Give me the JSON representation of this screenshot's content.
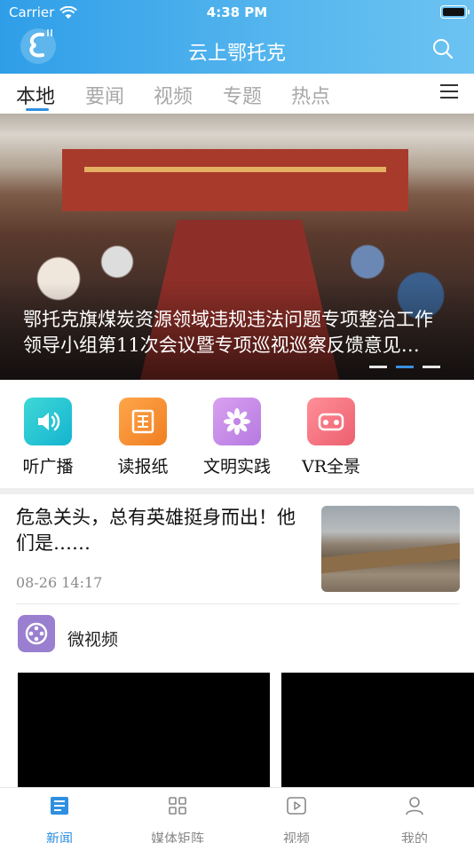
{
  "status_bar": {
    "carrier": "Carrier",
    "time": "4:38 PM"
  },
  "header": {
    "title": "云上鄂托克"
  },
  "tabs": [
    {
      "label": "本地",
      "active": true
    },
    {
      "label": "要闻"
    },
    {
      "label": "视频"
    },
    {
      "label": "专题"
    },
    {
      "label": "热点"
    }
  ],
  "banner": {
    "caption_line1": "鄂托克旗煤炭资源领域违规违法问题专项整治工作",
    "caption_line2": "领导小组第11次会议暨专项巡视巡察反馈意见…",
    "pages": 3,
    "current_page": 2
  },
  "quick_links": [
    {
      "label": "听广播",
      "icon": "speaker-icon",
      "color": "#27c6cf"
    },
    {
      "label": "读报纸",
      "icon": "newspaper-icon",
      "color": "#f48a2e"
    },
    {
      "label": "文明实践",
      "icon": "flower-icon",
      "color": "#c98ae8"
    },
    {
      "label": "VR全景",
      "icon": "vr-goggles-icon",
      "color": "#f06f7c"
    }
  ],
  "news": {
    "title": "危急关头，总有英雄挺身而出！他们是……",
    "time": "08-26  14:17"
  },
  "micro_video": {
    "label": "微视频"
  },
  "bottom_nav": [
    {
      "label": "新闻",
      "active": true
    },
    {
      "label": "媒体矩阵"
    },
    {
      "label": "视频"
    },
    {
      "label": "我的"
    }
  ],
  "colors": {
    "accent": "#2f8fe0",
    "header": "#4aaeea"
  }
}
